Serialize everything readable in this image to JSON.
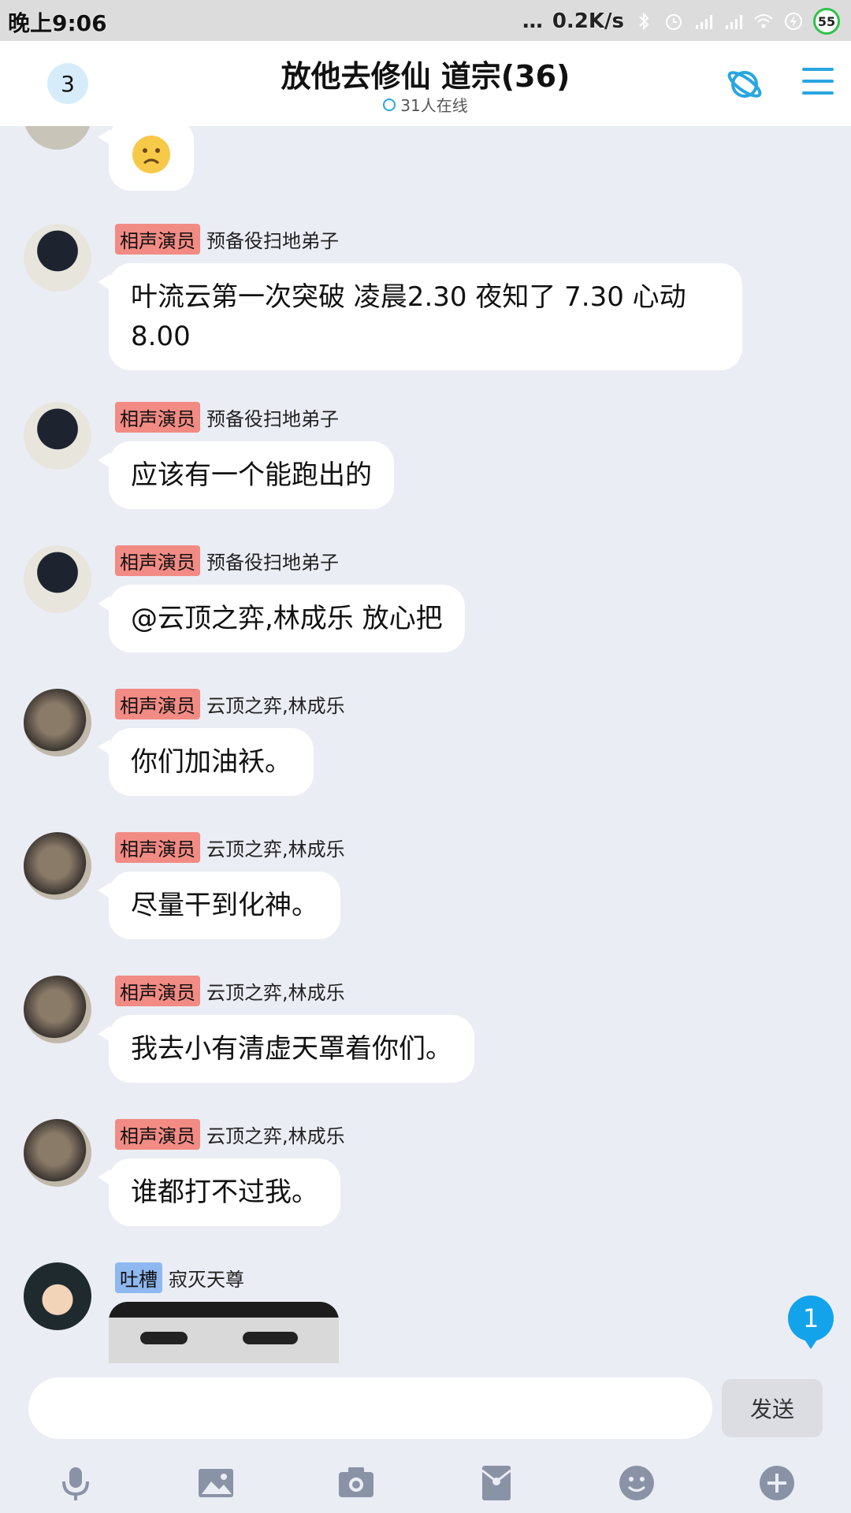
{
  "status_bar": {
    "time": "晚上9:06",
    "net_speed": "0.2K/s",
    "battery": "55"
  },
  "header": {
    "unread_count": "3",
    "title": "放他去修仙 道宗(36)",
    "online": "31人在线"
  },
  "messages": [
    {
      "tag": "相声演员",
      "name": "预备役扫地弟子",
      "text": "叶流云第一次突破  凌晨2.30  夜知了 7.30   心动8.00"
    },
    {
      "tag": "相声演员",
      "name": "预备役扫地弟子",
      "text": "应该有一个能跑出的"
    },
    {
      "tag": "相声演员",
      "name": "预备役扫地弟子",
      "text": "@云顶之弈,林成乐 放心把"
    },
    {
      "tag": "相声演员",
      "name": "云顶之弈,林成乐",
      "text": "你们加油袄。"
    },
    {
      "tag": "相声演员",
      "name": "云顶之弈,林成乐",
      "text": "尽量干到化神。"
    },
    {
      "tag": "相声演员",
      "name": "云顶之弈,林成乐",
      "text": "我去小有清虚天罩着你们。"
    },
    {
      "tag": "相声演员",
      "name": "云顶之弈,林成乐",
      "text": "谁都打不过我。"
    },
    {
      "tag": "吐槽",
      "name": "寂灭天尊",
      "text": ""
    }
  ],
  "new_message_badge": "1",
  "composer": {
    "placeholder": "",
    "send_label": "发送"
  },
  "toolbar_icons": [
    "microphone-icon",
    "image-icon",
    "camera-icon",
    "red-packet-icon",
    "emoji-icon",
    "plus-icon"
  ],
  "colors": {
    "accent": "#2aa6e0",
    "tag_red": "#f28b84",
    "tag_blue": "#8fb8f0",
    "chat_bg": "#ebedf5"
  }
}
